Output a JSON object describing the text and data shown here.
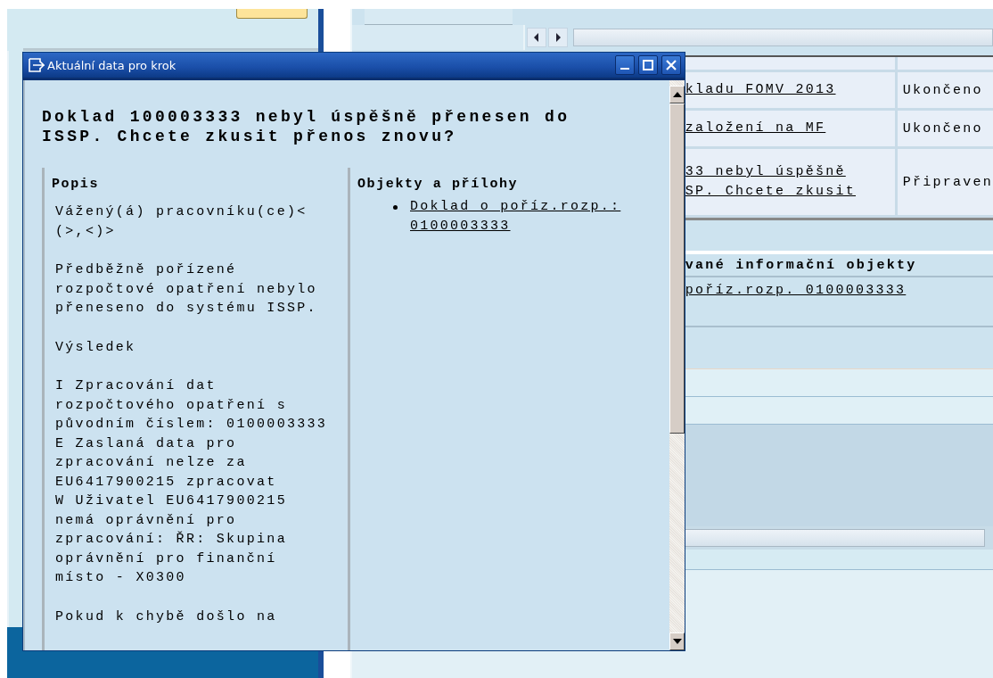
{
  "background": {
    "steps": [
      {
        "step": [
          "kladu FOMV 2013"
        ],
        "status": "Ukončeno"
      },
      {
        "step": [
          "založení na MF"
        ],
        "status": "Ukončeno"
      },
      {
        "step": [
          "33 nebyl úspěšně",
          "SP. Chcete zkusit"
        ],
        "status": "Připraven"
      }
    ],
    "info_objects": {
      "header": "vané informační objekty",
      "items": [
        "poříz.rozp. 0100003333"
      ]
    }
  },
  "dialog": {
    "title": "Aktuální data pro krok",
    "heading": [
      "Doklad 100003333 nebyl úspěšně přenesen do",
      "ISSP. Chcete zkusit přenos znovu?"
    ],
    "description": {
      "title": "Popis",
      "paragraphs": [
        {
          "lines": [
            "Vážený(á) pracovníku(ce)<",
            "(>,<)>"
          ]
        },
        {
          "lines": [
            "Předběžně pořízené",
            "rozpočtové opatření nebylo",
            "přeneseno do systému ISSP."
          ]
        },
        {
          "lines": [
            "Výsledek"
          ]
        },
        {
          "lines": [
            "I Zpracování dat",
            "rozpočtového opatření s",
            "původním číslem: 0100003333",
            "E Zaslaná data pro",
            "zpracování nelze za",
            "EU6417900215 zpracovat",
            "W Uživatel EU6417900215",
            "nemá oprávnění pro",
            "zpracování: ŘR: Skupina",
            "oprávnění pro finanční",
            "místo - X0300"
          ]
        },
        {
          "lines": [
            "Pokud k chybě došlo na"
          ]
        }
      ]
    },
    "objects": {
      "title": "Objekty a přílohy",
      "items": [
        {
          "lines": [
            "Doklad o poříz.rozp.:",
            "0100003333"
          ]
        }
      ]
    }
  }
}
